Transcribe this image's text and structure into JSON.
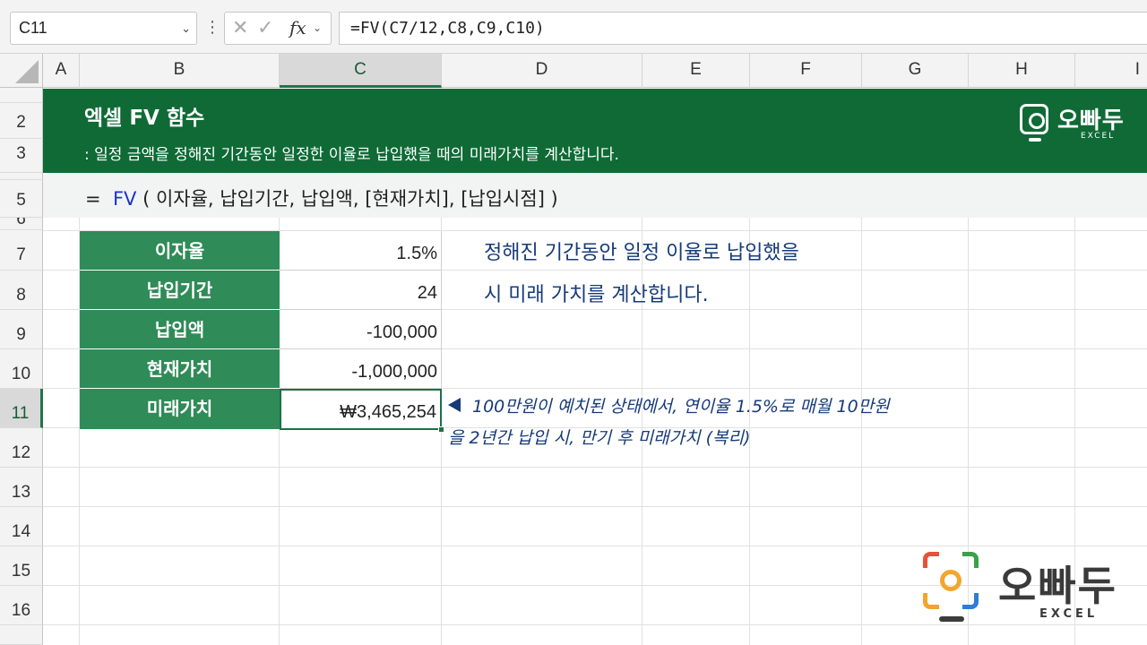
{
  "formula_bar": {
    "name_box": "C11",
    "cancel_icon": "close-icon",
    "enter_icon": "check-icon",
    "fx_label": "fx",
    "formula": "=FV(C7/12,C8,C9,C10)"
  },
  "columns": [
    "A",
    "B",
    "C",
    "D",
    "E",
    "F",
    "G",
    "H",
    "I"
  ],
  "selected_column": "C",
  "rows": [
    "2",
    "3",
    "5",
    "6",
    "7",
    "8",
    "9",
    "10",
    "11",
    "12",
    "13",
    "14",
    "15",
    "16"
  ],
  "selected_row": "11",
  "banner": {
    "title": "엑셀 FV 함수",
    "subtitle": ": 일정 금액을 정해진 기간동안 일정한 이율로 납입했을 때의 미래가치를 계산합니다.",
    "logo_text": "오빠두",
    "logo_sub": "EXCEL"
  },
  "syntax": {
    "prefix": "=  ",
    "function": "FV",
    "args": " ( 이자율, 납입기간, 납입액, [현재가치], [납입시점] )"
  },
  "table": [
    {
      "label": "이자율",
      "value": "1.5%"
    },
    {
      "label": "납입기간",
      "value": "24"
    },
    {
      "label": "납입액",
      "value": "-100,000"
    },
    {
      "label": "현재가치",
      "value": "-1,000,000"
    },
    {
      "label": "미래가치",
      "value": "₩3,465,254"
    }
  ],
  "note_big": {
    "line1": "정해진 기간동안 일정 이율로 납입했을",
    "line2": "시 미래 가치를 계산합니다."
  },
  "note_italic": {
    "line1": "100만원이 예치된 상태에서, 연이율 1.5%로 매월 10만원",
    "line2": "을 2년간 납입 시, 만기 후 미래가치 (복리)"
  },
  "logo_big": {
    "text": "오빠두",
    "sub": "EXCEL"
  },
  "colors": {
    "banner_green": "#0f6a36",
    "table_green": "#2f8b57",
    "note_blue": "#163a78",
    "function_blue": "#1a36c9"
  }
}
